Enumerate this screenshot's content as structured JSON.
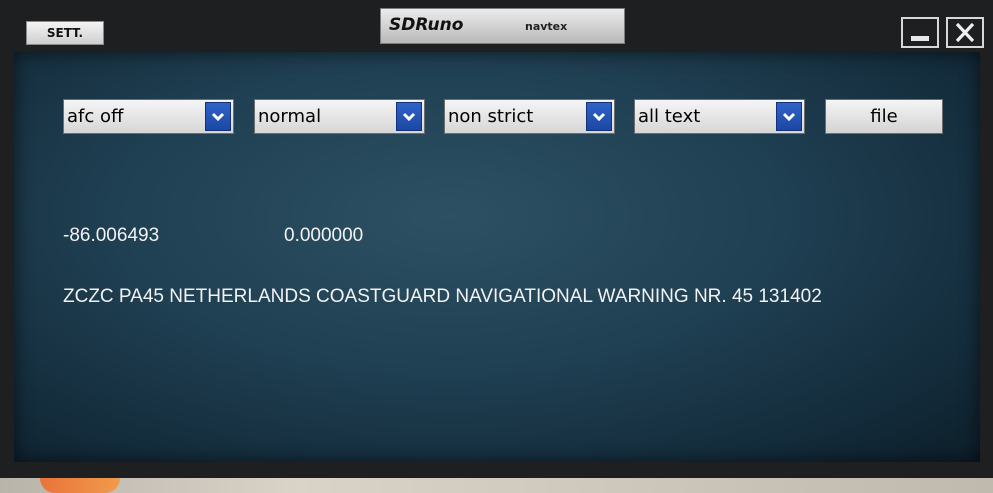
{
  "titlebar": {
    "settings_label": "SETT.",
    "app_name": "SDRuno",
    "mode_label": "navtex"
  },
  "controls": {
    "afc": {
      "selected": "afc off"
    },
    "mode": {
      "selected": "normal"
    },
    "strictness": {
      "selected": "non strict"
    },
    "filter": {
      "selected": "all text"
    },
    "file_label": "file"
  },
  "readouts": {
    "value_1": "-86.006493",
    "value_2": "0.000000"
  },
  "decoded_text": "ZCZC PA45  NETHERLANDS COASTGUARD  NAVIGATIONAL WARNING NR. 45 131402",
  "colors": {
    "panel": "#1f3f52",
    "frame": "#1e1f20",
    "dropdown_arrow": "#2f63c8",
    "text": "#f2f2f2"
  }
}
